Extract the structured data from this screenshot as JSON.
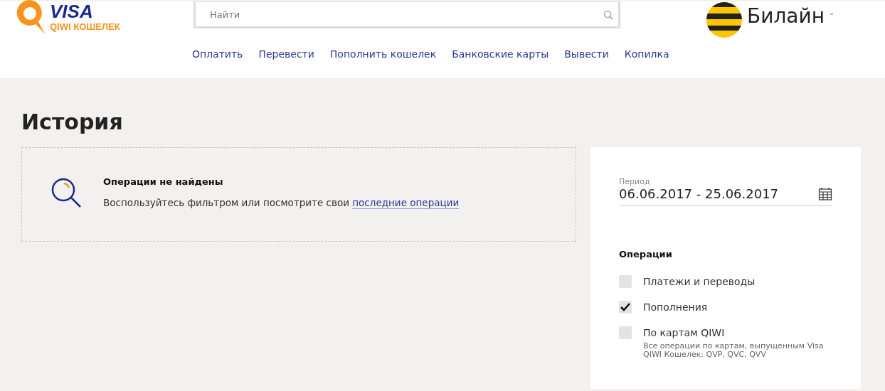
{
  "header": {
    "logo": {
      "top": "VISA",
      "bottom": "QIWI КОШЕЛЕК"
    },
    "search": {
      "placeholder": "Найти"
    },
    "partner": {
      "name": "Билайн",
      "mark": "™"
    }
  },
  "nav": [
    "Оплатить",
    "Перевести",
    "Пополнить кошелек",
    "Банковские карты",
    "Вывести",
    "Копилка"
  ],
  "page": {
    "title": "История"
  },
  "empty": {
    "title": "Операции не найдены",
    "text": "Воспользуйтесь фильтром или посмотрите свои ",
    "link": "последние операции"
  },
  "filter": {
    "period": {
      "label": "Период",
      "value": "06.06.2017 - 25.06.2017"
    },
    "operations_title": "Операции",
    "options": [
      {
        "label": "Платежи и переводы",
        "checked": false
      },
      {
        "label": "Пополнения",
        "checked": true
      },
      {
        "label": "По картам QIWI",
        "checked": false,
        "hint": "Все операции по картам, выпущенным Visa QIWI Кошелек: QVP, QVC, QVV"
      }
    ]
  }
}
